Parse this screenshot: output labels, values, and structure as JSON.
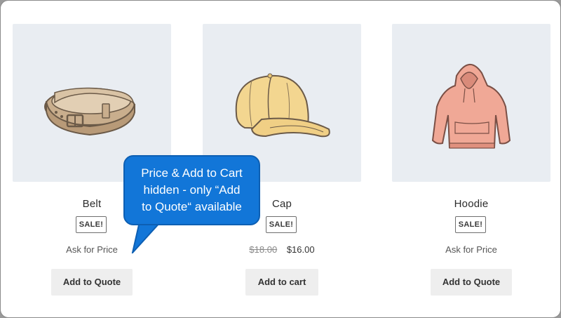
{
  "products": [
    {
      "title": "Belt",
      "badge": "SALE!",
      "price_text": "Ask for Price",
      "button_label": "Add to Quote",
      "icon": "belt-image"
    },
    {
      "title": "Cap",
      "badge": "SALE!",
      "price_old": "$18.00",
      "price_new": "$16.00",
      "button_label": "Add to cart",
      "icon": "cap-image"
    },
    {
      "title": "Hoodie",
      "badge": "SALE!",
      "price_text": "Ask for Price",
      "button_label": "Add to Quote",
      "icon": "hoodie-image"
    }
  ],
  "callout": {
    "lines": [
      "Price & Add to Cart",
      "hidden - only “Add",
      "to Quote“ available"
    ]
  },
  "colors": {
    "thumb_bg": "#e9edf2",
    "button_bg": "#eeeeee",
    "callout_bg": "#1276d8"
  }
}
